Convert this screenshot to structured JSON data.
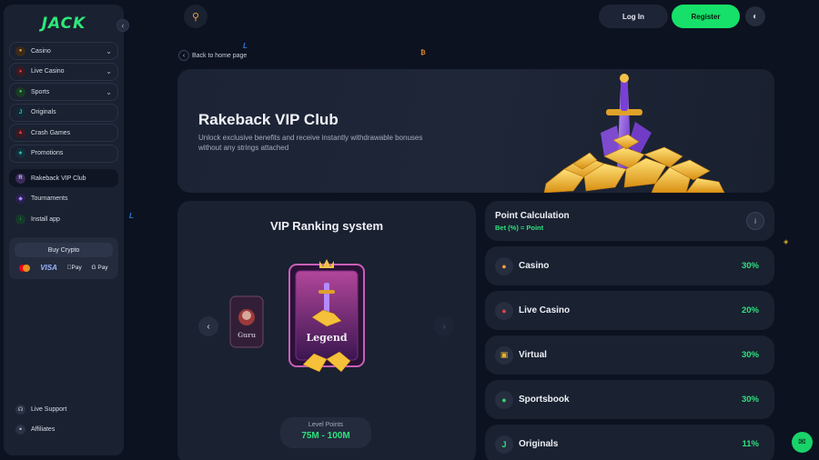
{
  "brand": {
    "logo": "JACK"
  },
  "sidebar": {
    "items": [
      {
        "label": "Casino",
        "icon": "casino-icon",
        "expandable": true
      },
      {
        "label": "Live Casino",
        "icon": "live-casino-icon",
        "expandable": true
      },
      {
        "label": "Sports",
        "icon": "sports-icon",
        "expandable": true
      },
      {
        "label": "Originals",
        "icon": "originals-icon",
        "expandable": false
      },
      {
        "label": "Crash Games",
        "icon": "crash-games-icon",
        "expandable": false
      },
      {
        "label": "Promotions",
        "icon": "promotions-icon",
        "expandable": false
      }
    ],
    "secondary": [
      {
        "label": "Rakeback VIP Club",
        "icon": "vip-club-icon",
        "active": true
      },
      {
        "label": "Tournaments",
        "icon": "tournaments-icon"
      },
      {
        "label": "Install app",
        "icon": "install-app-icon"
      }
    ],
    "buy_crypto": {
      "label": "Buy Crypto",
      "methods": [
        "mastercard",
        "VISA",
        "Pay",
        "G Pay"
      ]
    },
    "bottom": [
      {
        "label": "Live Support",
        "icon": "headset-icon"
      },
      {
        "label": "Affiliates",
        "icon": "affiliates-icon"
      }
    ]
  },
  "header": {
    "login_label": "Log In",
    "register_label": "Register"
  },
  "back_link": "Back to home page",
  "hero": {
    "title": "Rakeback VIP Club",
    "subtitle": "Unlock exclusive benefits and receive instantly withdrawable bonuses without any strings attached"
  },
  "vip_ranking": {
    "title": "VIP Ranking system",
    "prev_tier": "Guru",
    "current_tier": "Legend",
    "level_points_label": "Level Points",
    "level_points_value": "75M - 100M"
  },
  "point_calculation": {
    "title": "Point Calculation",
    "formula": "Bet (%) = Point",
    "rows": [
      {
        "label": "Casino",
        "value": "30%",
        "icon": "casino-icon"
      },
      {
        "label": "Live Casino",
        "value": "20%",
        "icon": "live-casino-icon"
      },
      {
        "label": "Virtual",
        "value": "30%",
        "icon": "virtual-icon"
      },
      {
        "label": "Sportsbook",
        "value": "30%",
        "icon": "sportsbook-icon"
      },
      {
        "label": "Originals",
        "value": "11%",
        "icon": "originals-icon"
      }
    ]
  },
  "colors": {
    "accent": "#16e069",
    "background": "#0c1220",
    "panel": "#1a2131"
  }
}
